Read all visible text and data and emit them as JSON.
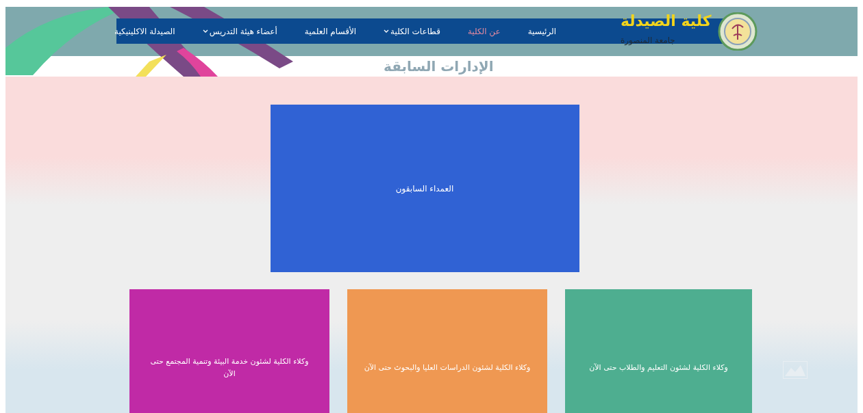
{
  "header": {
    "logo_title": "كلية الصيدلة",
    "logo_subtitle": "جامعة المنصورة",
    "page_title": "الإدارات السابقة"
  },
  "nav": [
    {
      "label": "الرئيسية",
      "selected": false,
      "dropdown": false
    },
    {
      "label": "عن الكلية",
      "selected": true,
      "dropdown": false
    },
    {
      "label": "قطاعات الكلية",
      "selected": false,
      "dropdown": true
    },
    {
      "label": "الأقسام العلمية",
      "selected": false,
      "dropdown": false
    },
    {
      "label": "أعضاء هيئة التدريس",
      "selected": false,
      "dropdown": true
    },
    {
      "label": "الصيدلة الاكلينيكية",
      "selected": false,
      "dropdown": false
    }
  ],
  "main_card": {
    "label": "العمداء السابقون",
    "color": "#3062d4"
  },
  "cards": [
    {
      "label": "وكلاء الكلية لشئون التعليم والطلاب حتى الآن",
      "color": "#4eae90"
    },
    {
      "label": "وكلاء الكلية لشئون الدراسات العليا والبحوث حتى الآن",
      "color": "#ef9852"
    },
    {
      "label": "وكلاء الكلية لشئون خدمة البيئة وتنمية المجتمع حتى الآن",
      "color": "#c02aa6"
    }
  ]
}
